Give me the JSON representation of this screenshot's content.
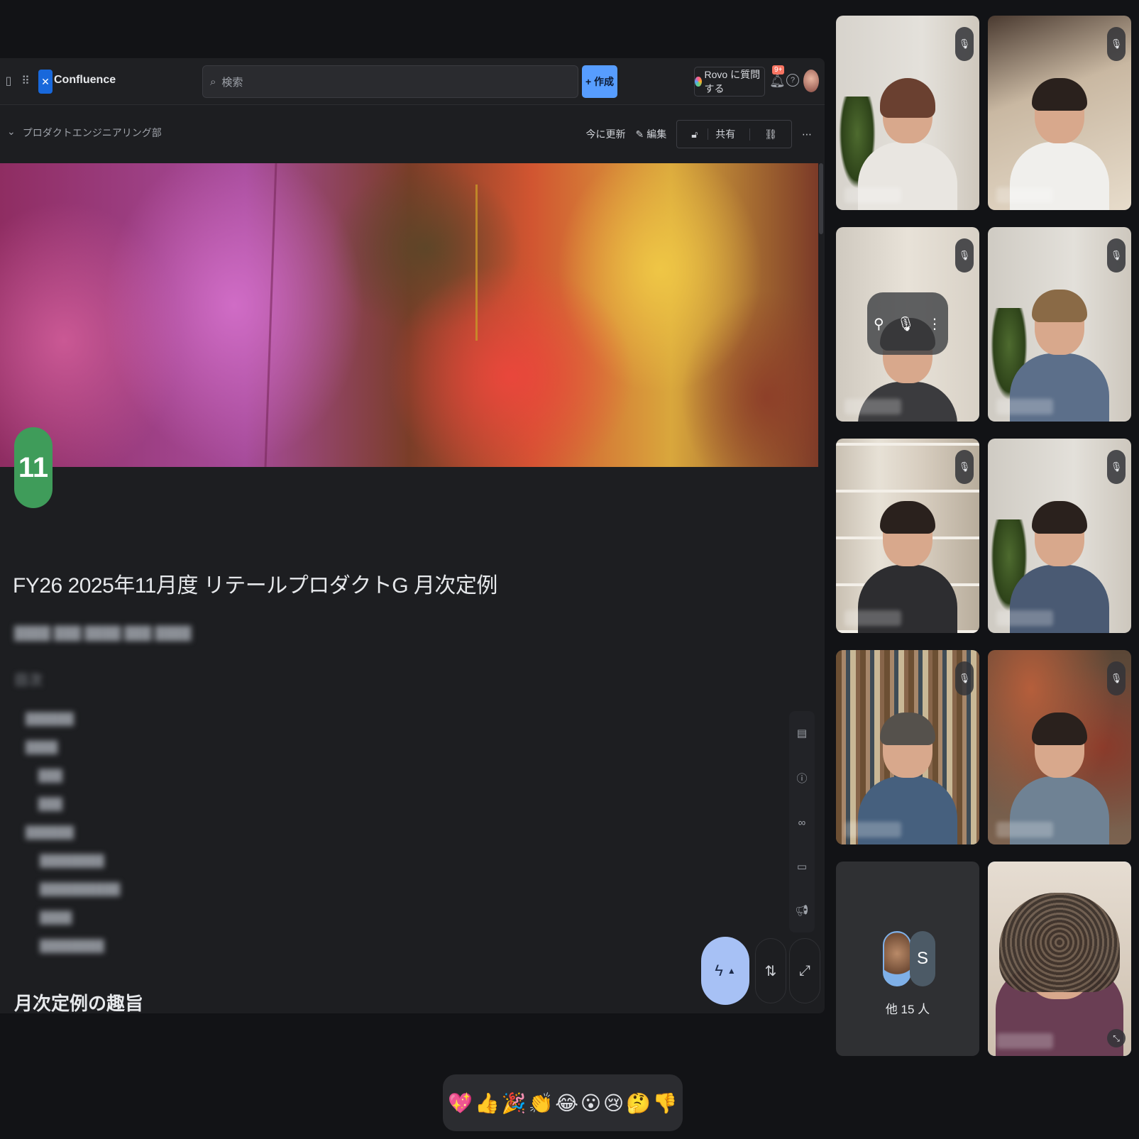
{
  "confluence": {
    "app_name": "Confluence",
    "search_placeholder": "検索",
    "create_label": "+ 作成",
    "rovo_label": "Rovo に質問する",
    "notifications_badge": "9+",
    "breadcrumb": "プロダクトエンジニアリング部",
    "actions": {
      "updated": "今に更新",
      "edit": "編集",
      "share": "共有"
    },
    "page_emoji_text": "11",
    "page_title": "FY26 2025年11月度 リテールプロダクトG 月次定例",
    "section_heading": "月次定例の趣旨",
    "blurred": {
      "meta": "████ ███ ████ ███ ████",
      "toc_title": "目次",
      "toc_items": [
        "██████",
        "████",
        "███",
        "███",
        "██████",
        "████████",
        "██████████",
        "████",
        "████████"
      ]
    }
  },
  "meet": {
    "others_label": "他 15 人",
    "others_initial": "S"
  },
  "reactions": [
    "💖",
    "👍",
    "🎉",
    "👏",
    "😂",
    "😮",
    "😢",
    "🤔",
    "👎"
  ],
  "colors": {
    "accent": "#579dff",
    "selected_outline": "#8ab4f8",
    "background": "#121316"
  }
}
